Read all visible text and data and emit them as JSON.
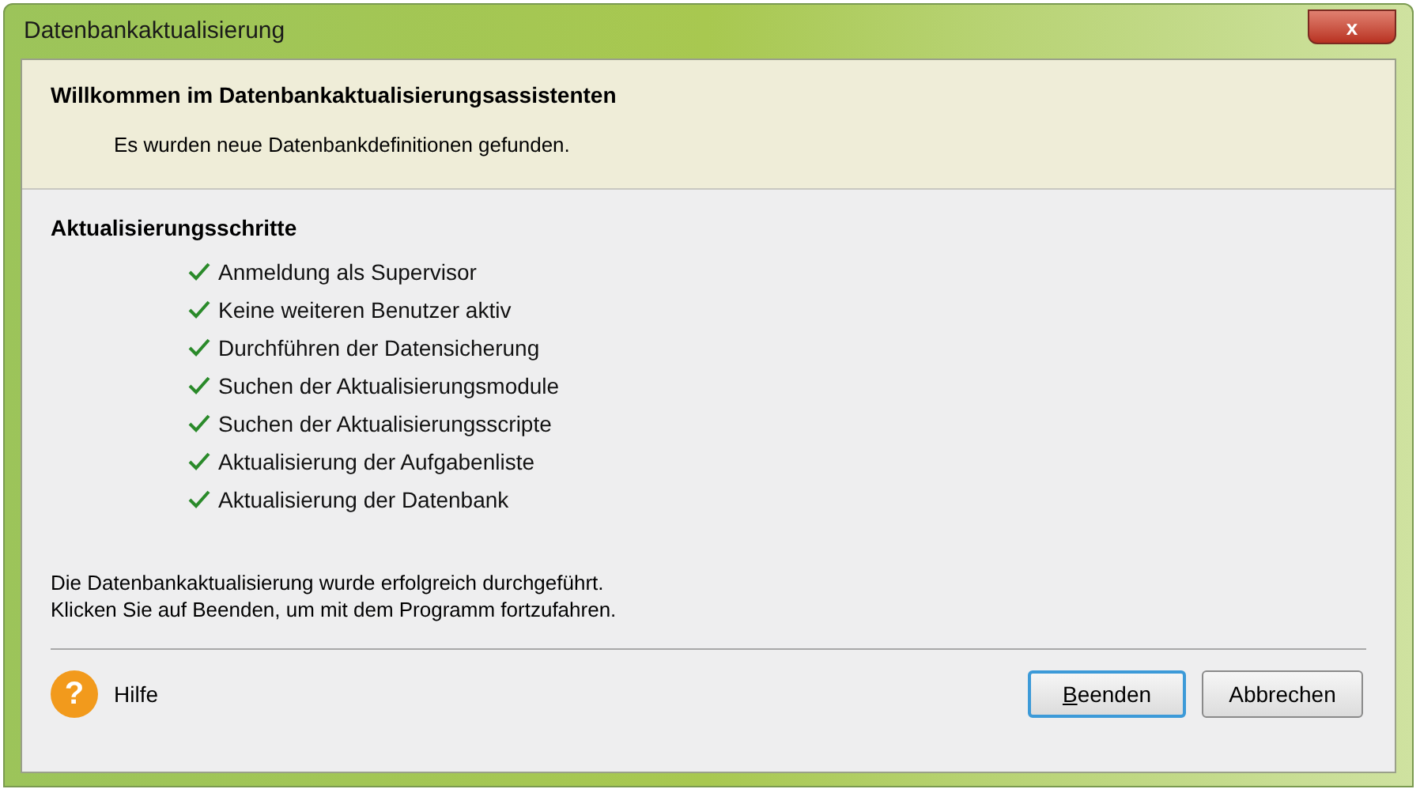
{
  "window": {
    "title": "Datenbankaktualisierung",
    "close": "x"
  },
  "header": {
    "title": "Willkommen im Datenbankaktualisierungsassistenten",
    "subtitle": "Es wurden neue Datenbankdefinitionen gefunden."
  },
  "steps": {
    "title": "Aktualisierungsschritte",
    "items": [
      {
        "label": "Anmeldung als Supervisor",
        "done": true
      },
      {
        "label": "Keine weiteren Benutzer aktiv",
        "done": true
      },
      {
        "label": "Durchführen der Datensicherung",
        "done": true
      },
      {
        "label": "Suchen der Aktualisierungsmodule",
        "done": true
      },
      {
        "label": "Suchen der Aktualisierungsscripte",
        "done": true
      },
      {
        "label": "Aktualisierung der Aufgabenliste",
        "done": true
      },
      {
        "label": "Aktualisierung der Datenbank",
        "done": true
      }
    ]
  },
  "message": [
    "Die Datenbankaktualisierung wurde erfolgreich durchgeführt.",
    "Klicken Sie auf Beenden, um mit dem Programm fortzufahren."
  ],
  "help": {
    "icon": "?",
    "label": "Hilfe"
  },
  "buttons": [
    {
      "label": "Beenden",
      "default": true,
      "mnemonic": true
    },
    {
      "label": "Abbrechen",
      "default": false,
      "mnemonic": false
    }
  ]
}
